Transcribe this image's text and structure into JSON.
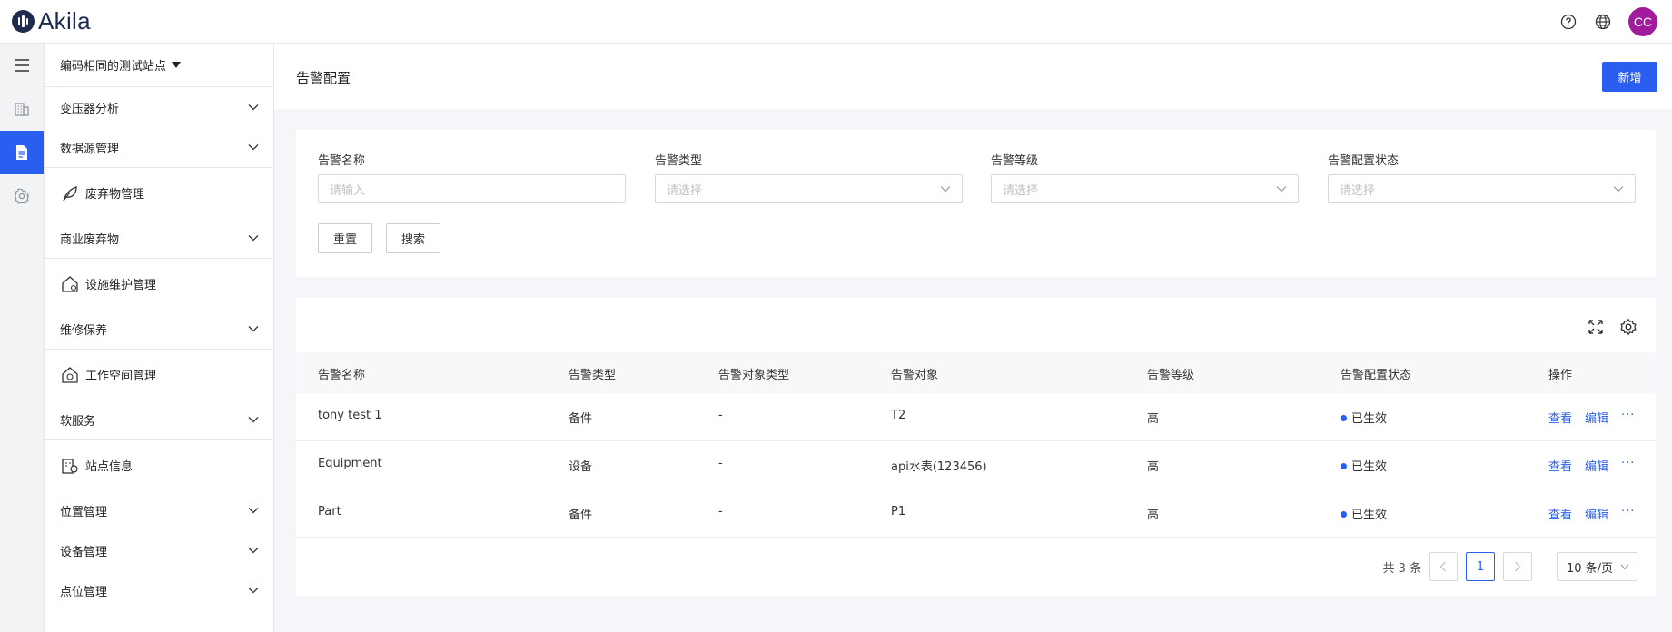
{
  "app": {
    "logo_text": "Akila",
    "avatar_initials": "CC"
  },
  "sidebar": {
    "site_name": "编码相同的测试站点",
    "items": [
      {
        "type": "item",
        "label": "变压器分析"
      },
      {
        "type": "item",
        "label": "数据源管理"
      },
      {
        "type": "group",
        "label": "废弃物管理",
        "icon": "leaf-icon"
      },
      {
        "type": "item",
        "label": "商业废弃物"
      },
      {
        "type": "group",
        "label": "设施维护管理",
        "icon": "house-gear-icon"
      },
      {
        "type": "item",
        "label": "维修保养"
      },
      {
        "type": "group",
        "label": "工作空间管理",
        "icon": "house-check-icon"
      },
      {
        "type": "item",
        "label": "软服务"
      },
      {
        "type": "group",
        "label": "站点信息",
        "icon": "building-pin-icon"
      },
      {
        "type": "item",
        "label": "位置管理"
      },
      {
        "type": "item",
        "label": "设备管理"
      },
      {
        "type": "item",
        "label": "点位管理"
      }
    ]
  },
  "page": {
    "title": "告警配置",
    "add_label": "新增"
  },
  "filters": {
    "name_label": "告警名称",
    "name_placeholder": "请输入",
    "type_label": "告警类型",
    "type_placeholder": "请选择",
    "level_label": "告警等级",
    "level_placeholder": "请选择",
    "status_label": "告警配置状态",
    "status_placeholder": "请选择",
    "reset_label": "重置",
    "search_label": "搜索"
  },
  "table": {
    "columns": [
      "告警名称",
      "告警类型",
      "告警对象类型",
      "告警对象",
      "告警等级",
      "告警配置状态",
      "操作"
    ],
    "rows": [
      {
        "name": "tony test 1",
        "type": "备件",
        "object_type": "-",
        "object": "T2",
        "level": "高",
        "status": "已生效"
      },
      {
        "name": "Equipment",
        "type": "设备",
        "object_type": "-",
        "object": "api水表(123456)",
        "level": "高",
        "status": "已生效"
      },
      {
        "name": "Part",
        "type": "备件",
        "object_type": "-",
        "object": "P1",
        "level": "高",
        "status": "已生效"
      }
    ],
    "view_label": "查看",
    "edit_label": "编辑",
    "more_label": "···"
  },
  "pagination": {
    "total": "共 3 条",
    "current_page": "1",
    "page_size": "10 条/页"
  },
  "colors": {
    "accent": "#2a5ef0",
    "avatar": "#a01c9c",
    "logo": "#1e2b4f"
  }
}
